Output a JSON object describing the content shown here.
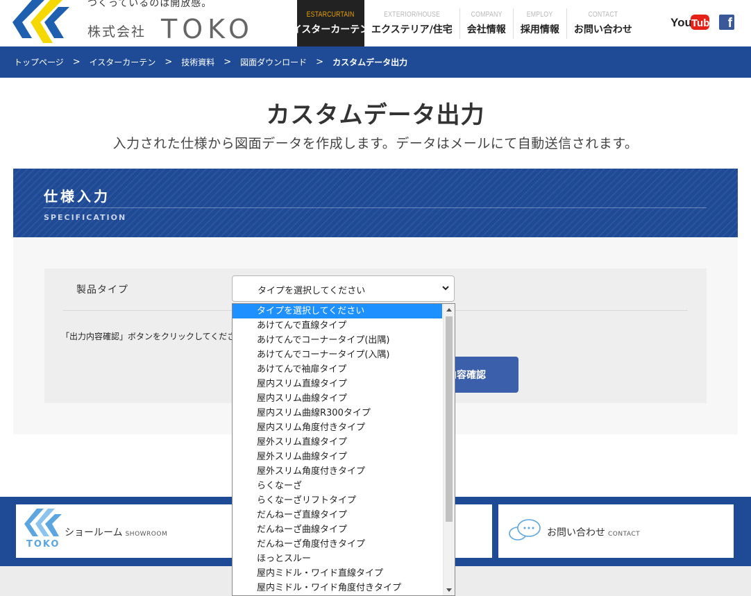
{
  "header": {
    "tagline": "つくっているのは開放感。",
    "company_jp": "株式会社",
    "company_en": "TOKO",
    "nav": [
      {
        "en": "ESTARCURTAIN",
        "jp": "イスターカーテン",
        "active": true
      },
      {
        "en": "EXTERIOR/HOUSE",
        "jp": "エクステリア/住宅"
      },
      {
        "en": "COMPANY",
        "jp": "会社情報"
      },
      {
        "en": "EMPLOY",
        "jp": "採用情報"
      },
      {
        "en": "CONTACT",
        "jp": "お問い合わせ"
      }
    ],
    "youtube_label": "YouTube",
    "facebook_label": "f"
  },
  "breadcrumb": [
    "トップページ",
    "イスターカーテン",
    "技術資料",
    "図面ダウンロード",
    "カスタムデータ出力"
  ],
  "page": {
    "title": "カスタムデータ出力",
    "subtitle": "入力された仕様から図面データを作成します。データはメールにて自動送信されます。"
  },
  "section": {
    "title": "仕様入力",
    "en": "SPECIFICATION"
  },
  "form": {
    "product_type_label": "製品タイプ",
    "select_value": "タイプを選択してください",
    "note": "「出力内容確認」ボタンをクリックしてください。",
    "confirm_button": "出力内容確認"
  },
  "dropdown": {
    "options": [
      "タイプを選択してください",
      "あけてんで直線タイプ",
      "あけてんでコーナータイプ(出隅)",
      "あけてんでコーナータイプ(入隅)",
      "あけてんで袖扉タイプ",
      "屋内スリム直線タイプ",
      "屋内スリム曲線タイプ",
      "屋内スリム曲線R300タイプ",
      "屋内スリム角度付きタイプ",
      "屋外スリム直線タイプ",
      "屋外スリム曲線タイプ",
      "屋外スリム角度付きタイプ",
      "らくなーざ",
      "らくなーざリフトタイプ",
      "だんねーざ直線タイプ",
      "だんねーざ曲線タイプ",
      "だんねーざ角度付きタイプ",
      "ほっとスルー",
      "屋内ミドル・ワイド直線タイプ",
      "屋内ミドル・ワイド角度付きタイプ"
    ],
    "selected_index": 0
  },
  "footer": {
    "showroom_label": "ショールーム",
    "showroom_en": "SHOWROOM",
    "toko_logo_text": "TOKO",
    "contact_label": "お問い合わせ",
    "contact_en": "CONTACT"
  },
  "colors": {
    "brand_blue": "#1f4a96",
    "button_blue": "#3b5faa",
    "accent_orange": "#e8a000",
    "logo_yellow": "#f5d800",
    "selected_option": "#1e90ff"
  }
}
